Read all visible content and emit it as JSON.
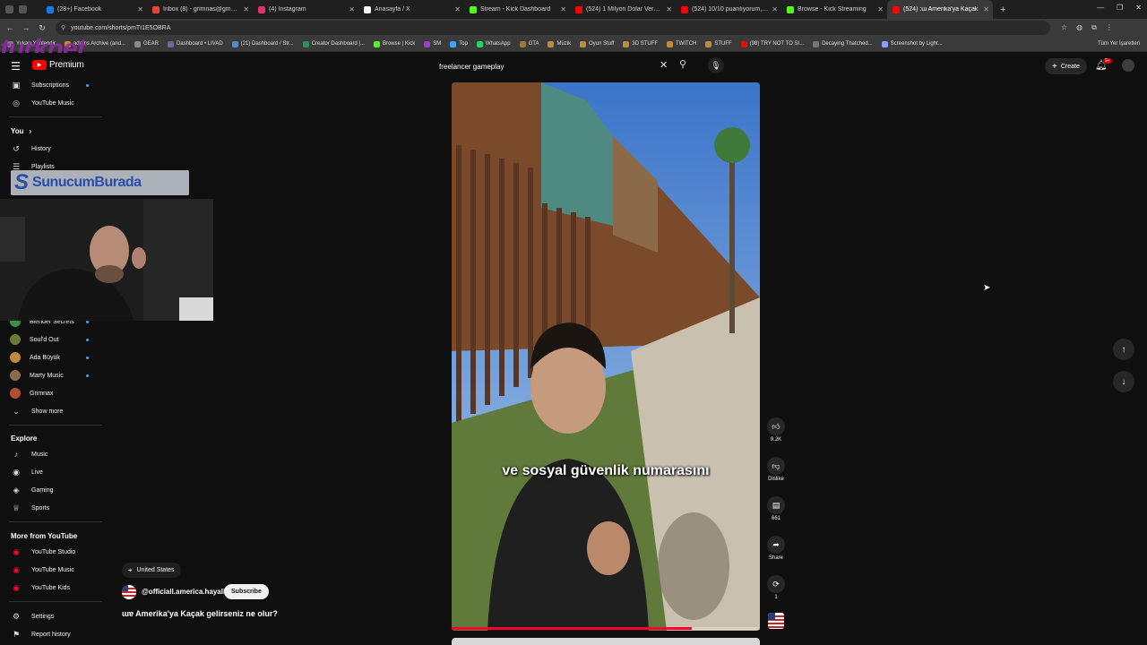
{
  "browser": {
    "tabs": [
      {
        "title": "(28+) Facebook",
        "color": "#1877f2"
      },
      {
        "title": "Inbox (8) - grimnas@gmail.com",
        "color": "#ea4335"
      },
      {
        "title": "(4) Instagram",
        "color": "#e1306c"
      },
      {
        "title": "Anasayfa / X",
        "color": "#ffffff"
      },
      {
        "title": "Stream - Kick Dashboard",
        "color": "#53fc18"
      },
      {
        "title": "(524) 1 Milyon Dolar Verecekle",
        "color": "#ff0000"
      },
      {
        "title": "(524) 10/10 puanlıyorum, kahv",
        "color": "#ff0000"
      },
      {
        "title": "Browse - Kick Streaming",
        "color": "#53fc18"
      },
      {
        "title": "(524) :ɯ Amerika'ya Kaçak",
        "color": "#ff0000",
        "active": true
      }
    ],
    "new_tab": "+",
    "url": "youtube.com/shorts/pmTI1E5OBRA",
    "bookmarks": [
      "Yukarı Yönlendir",
      "adams Archive (and...",
      "GEAR",
      "Dashboard • LIVAD",
      "(21) Dashboard / Str...",
      "Creator Dashboard |...",
      "Browse | Kick",
      "SM",
      "Top",
      "WhatsApp",
      "GTA",
      "Müzik",
      "Oyun Stuff",
      "3D STUFF",
      "TWITCH",
      "STUFF",
      "(98) TRY NOT TO SI...",
      "Decaying Thatched...",
      "Screenshot by Light..."
    ],
    "bookmarks_right": "Tüm Yer İşaretleri"
  },
  "watermark": "turknet",
  "header": {
    "logo_text": "Premium",
    "search_value": "freelancer gameplay",
    "create_label": "Create",
    "notif_count": "9+"
  },
  "sidebar": {
    "top_items": [
      {
        "label": "Subscriptions",
        "icon": "▣",
        "dot": true
      },
      {
        "label": "YouTube Music",
        "icon": "◎",
        "dot": false
      }
    ],
    "you_header": "You",
    "you_items": [
      {
        "label": "History",
        "icon": "↺"
      },
      {
        "label": "Playlists",
        "icon": "☰"
      }
    ],
    "subscriptions": [
      {
        "label": "Blender Secrets",
        "color": "#3a8f4a"
      },
      {
        "label": "Soul'd Out",
        "color": "#6a7a3a"
      },
      {
        "label": "Ada Büyük",
        "color": "#c08a3a"
      },
      {
        "label": "Marty Music",
        "color": "#8a6a4a"
      },
      {
        "label": "Grimnax",
        "color": "#b05030"
      }
    ],
    "show_more": "Show more",
    "explore_header": "Explore",
    "explore_items": [
      {
        "label": "Music",
        "icon": "♪"
      },
      {
        "label": "Live",
        "icon": "◉"
      },
      {
        "label": "Gaming",
        "icon": "◈"
      },
      {
        "label": "Sports",
        "icon": "♕"
      }
    ],
    "more_header": "More from YouTube",
    "more_items": [
      {
        "label": "YouTube Studio"
      },
      {
        "label": "YouTube Music"
      },
      {
        "label": "YouTube Kids"
      }
    ],
    "settings": "Settings",
    "report": "Report history"
  },
  "overlay": {
    "banner_letter": "S",
    "banner_text": "SunucumBurada"
  },
  "short": {
    "caption": "ve sosyal güvenlik numarasını",
    "progress": 0.78,
    "location": "United States",
    "channel": "@officiall.america.hayali",
    "subscribe_label": "Subscribe",
    "title": "ɯɐ Amerika'ya Kaçak gelirseniz ne olur?",
    "actions": {
      "likes": "9.2K",
      "dislike": "Dislike",
      "comments": "661",
      "share": "Share",
      "remix": "1"
    }
  }
}
